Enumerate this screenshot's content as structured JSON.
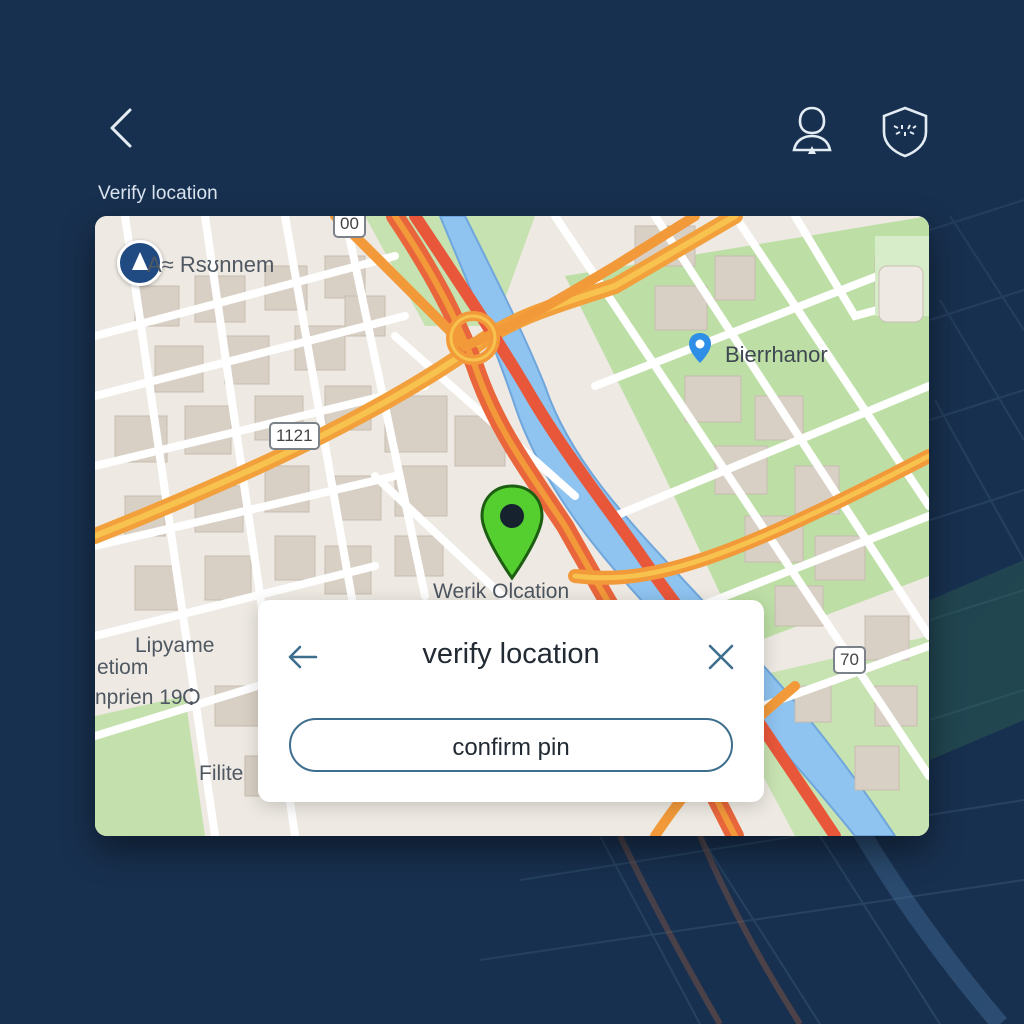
{
  "header": {
    "back_icon": "chevron-left-icon",
    "profile_icon": "person-location-icon",
    "shield_icon": "shield-icon",
    "screen_label": "Verify location"
  },
  "map": {
    "labels": {
      "north_west": "A≈ Rsʊnnem",
      "west_1": "Lipyame",
      "west_2": "etiom",
      "west_3": "nprien 19Ѻ",
      "west_4": "Filite",
      "place": "Bierrhanor",
      "pin_label": "Werik Olcation"
    },
    "road_signs": {
      "s1121": "1121",
      "s70": "70",
      "s00": "00"
    },
    "icons": [
      "compass-icon",
      "location-pin-icon",
      "map-pin-icon"
    ],
    "colors": {
      "land": "#eeeae3",
      "park": "#b9dca3",
      "water": "#8fc3f0",
      "highway": "#f29a3a",
      "highway_core": "#e8573a",
      "pin": "#55cf2f"
    }
  },
  "dialog": {
    "title": "verify location",
    "confirm_label": "confirm pin",
    "back_icon": "arrow-left-icon",
    "close_icon": "close-icon"
  }
}
